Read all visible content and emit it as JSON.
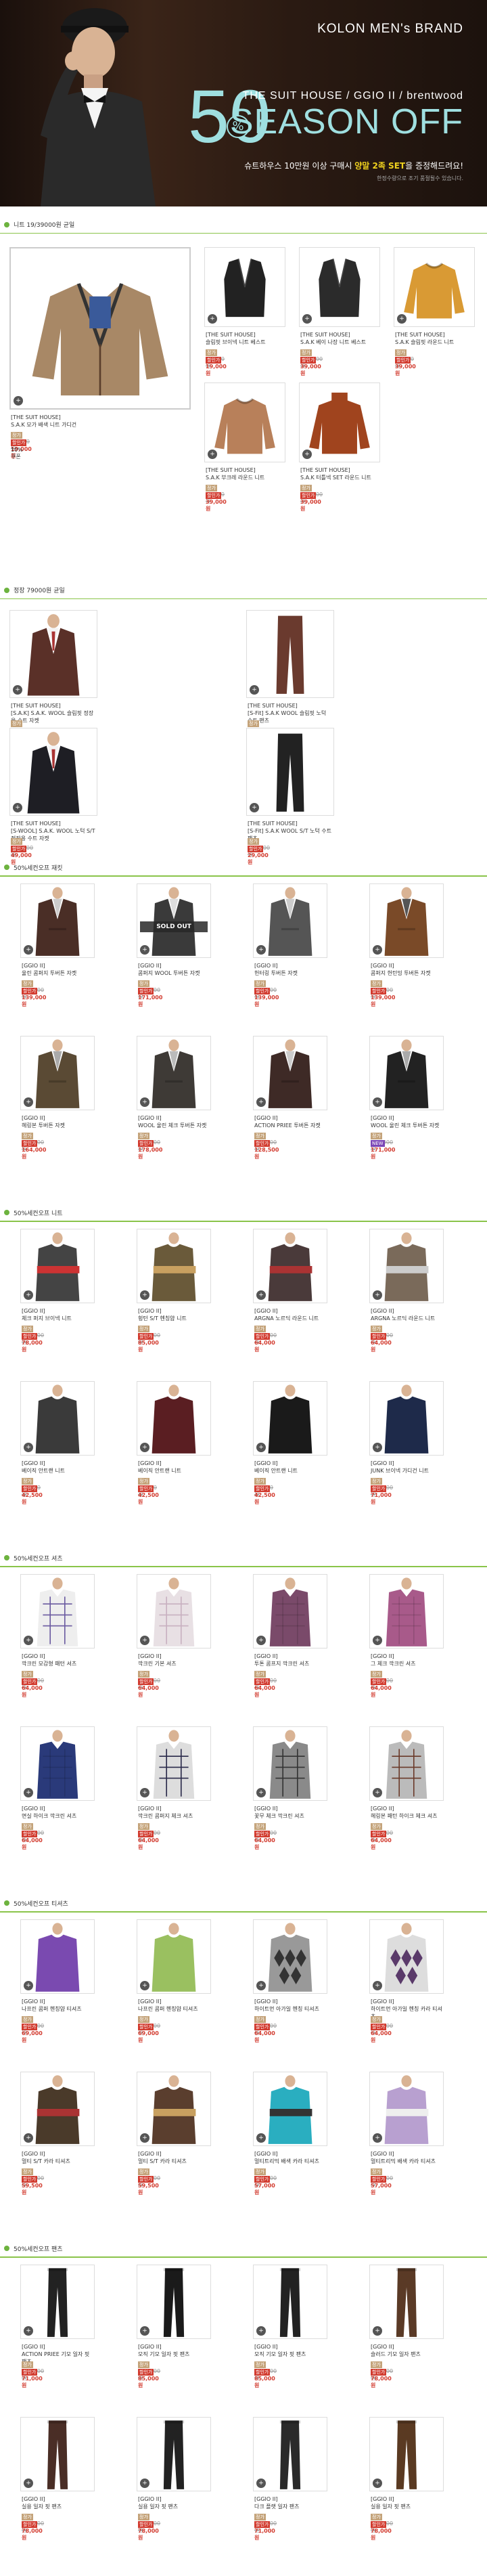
{
  "hero": {
    "brand": "KOLON MEN's BRAND",
    "percent": "50",
    "percent_sign": "%",
    "sub": "THE SUIT HOUSE / GGIO II / brentwood",
    "season": "SEASON OFF",
    "promo_pre": "슈트하우스 10만원 이상 구매시 ",
    "promo_hl": "양말 2족 SET",
    "promo_post": "을 증정해드려요!",
    "note": "한정수량으로 조기 품절될수 있습니다."
  },
  "sections": [
    {
      "title": "니트 19/39000원 균일"
    },
    {
      "title": "정장 79000원 균일"
    },
    {
      "title": "50%세컨오프 재킷"
    },
    {
      "title": "50%세컨오프 니트"
    },
    {
      "title": "50%세컨오프 셔츠"
    },
    {
      "title": "50%세컨오프 티셔츠"
    },
    {
      "title": "50%세컨오프 팬츠"
    }
  ],
  "knit": [
    {
      "name": "[THE SUIT HOUSE]\nS.A.K 모가 배색 니트 가디건",
      "orig": "99,000원",
      "now": "19,000원",
      "extra": "10% 쿠폰"
    },
    {
      "name": "[THE SUIT HOUSE]\n슬림핏 브이넥 니트 베스트",
      "orig": "75,000원",
      "now": "19,000원"
    },
    {
      "name": "[THE SUIT HOUSE]\nS.A.K 베이 나장 니트 베스트",
      "orig": "124,000원",
      "now": "39,000원"
    },
    {
      "name": "[THE SUIT HOUSE]\nS.A.K 슬림핏 라운드 니트",
      "orig": "99,000원",
      "now": "39,000원"
    },
    {
      "name": "[THE SUIT HOUSE]\nS.A.K 부크레 라운드 니트",
      "orig": "99,000원",
      "now": "39,000원"
    },
    {
      "name": "[THE SUIT HOUSE]\nS.A.K 터틀넥 SET 라운드 니트",
      "orig": "160,000원",
      "now": "39,000원"
    }
  ],
  "suit": [
    {
      "name": "[THE SUIT HOUSE]\n[S.A.K] S.A.K. WOOL 슬림핏 정장을 수트 자켓",
      "orig": "259,000원",
      "now": "49,000원"
    },
    {
      "name": "[THE SUIT HOUSE]\n[S-Fit] S.A.K WOOL 슬림핏 노턱 수트 팬츠",
      "orig": "129,000원",
      "now": "29,000원"
    },
    {
      "name": "[THE SUIT HOUSE]\n[S-WOOL] S.A.K. WOOL 노턱 S/T 정장용 수트 자켓",
      "orig": "269,000원",
      "now": "49,000원"
    },
    {
      "name": "[THE SUIT HOUSE]\n[S-Fit] S.A.K WOOL S/T 노턱 수트 팬츠",
      "orig": "149,000원",
      "now": "29,000원"
    }
  ],
  "jackets": [
    {
      "name": "[GGIO II]\n울린 콤퍼지 투버튼 자켓",
      "orig": "279,000원",
      "now": "139,000원",
      "sold": false
    },
    {
      "name": "[GGIO II]\n콤퍼지 WOOL 투버튼 자켓",
      "orig": "342,000원",
      "now": "171,000원",
      "sold": true,
      "sold_label": "SOLD OUT"
    },
    {
      "name": "[GGIO II]\n헌터링 투버튼 자켓",
      "orig": "279,000원",
      "now": "139,000원",
      "sold": false
    },
    {
      "name": "[GGIO II]\n콤퍼지 헌턴밍 투버튼 자켓",
      "orig": "279,000원",
      "now": "139,000원",
      "sold": false
    },
    {
      "name": "[GGIO II]\n헤링본 투버튼 자켓",
      "orig": "328,000원",
      "now": "164,000원",
      "sold": false
    },
    {
      "name": "[GGIO II]\nWOOL 울린 체크 투버튼 자켓",
      "orig": "356,000원",
      "now": "178,000원",
      "sold": false
    },
    {
      "name": "[GGIO II]\nACTION PRIEE 투버튼 자켓",
      "orig": "257,000원",
      "now": "128,500원",
      "sold": false
    },
    {
      "name": "[GGIO II]\nWOOL 울린 체크 투버튼 자켓",
      "orig": "342,000원",
      "now": "171,000원",
      "sold": false,
      "new": true
    }
  ],
  "knits2": [
    {
      "name": "[GGIO II]\n체크 퍼지 브이넥 니트",
      "orig": "156,000원",
      "now": "78,000원"
    },
    {
      "name": "[GGIO II]\n헝턴 S/T 헨칭얌 니트",
      "orig": "170,000원",
      "now": "85,000원"
    },
    {
      "name": "[GGIO II]\nARGNA 노르딕 라운드 니트",
      "orig": "128,000원",
      "now": "64,000원"
    },
    {
      "name": "[GGIO II]\nARGNA 노르딕 라운드 니트",
      "orig": "128,000원",
      "now": "64,000원"
    },
    {
      "name": "[GGIO II]\n베이직 안트랜 니트",
      "orig": "85,000원",
      "now": "42,500원"
    },
    {
      "name": "[GGIO II]\n베이직 안트랜 니트",
      "orig": "85,000원",
      "now": "42,500원"
    },
    {
      "name": "[GGIO II]\n베이직 안트랜 니트",
      "orig": "85,000원",
      "now": "42,500원"
    },
    {
      "name": "[GGIO II]\nJUNK 브이넥 가디건 니트",
      "orig": "142,000원",
      "now": "71,000원"
    }
  ],
  "shirts": [
    {
      "name": "[GGIO II]\n깍크린 모감형 패턴 셔츠",
      "orig": "128,000원",
      "now": "64,000원"
    },
    {
      "name": "[GGIO II]\n깍크린 기본 셔츠",
      "orig": "128,000원",
      "now": "64,000원"
    },
    {
      "name": "[GGIO II]\n투톤 콤프지 깍크린 셔츠",
      "orig": "128,000원",
      "now": "64,000원"
    },
    {
      "name": "[GGIO II]\n그 체크 깍크린 셔츠",
      "orig": "128,000원",
      "now": "64,000원"
    },
    {
      "name": "[GGIO II]\n면실 하이크 깍크린 셔츠",
      "orig": "128,000원",
      "now": "64,000원"
    },
    {
      "name": "[GGIO II]\n깍크린 콤퍼지 체크 셔츠",
      "orig": "128,000원",
      "now": "64,000원"
    },
    {
      "name": "[GGIO II]\n꽃무 체크 깍크린 셔츠",
      "orig": "128,000원",
      "now": "64,000원"
    },
    {
      "name": "[GGIO II]\n헤링본 패턴 하이크 체크 셔츠",
      "orig": "128,000원",
      "now": "64,000원"
    }
  ],
  "tees": [
    {
      "name": "[GGIO II]\n나프린 콤퍼 헨칭얌 티셔츠",
      "orig": "138,000원",
      "now": "69,000원"
    },
    {
      "name": "[GGIO II]\n나프린 콤퍼 헨칭얌 티셔츠",
      "orig": "138,000원",
      "now": "69,000원"
    },
    {
      "name": "[GGIO II]\n하이트먼 아가일 헨칭 티셔츠",
      "orig": "128,000원",
      "now": "64,000원"
    },
    {
      "name": "[GGIO II]\n하이트먼 아가일 헨칭 카라 티셔츠",
      "orig": "128,000원",
      "now": "64,000원"
    },
    {
      "name": "[GGIO II]\n멀티 S/T 카라 티셔츠",
      "orig": "119,000원",
      "now": "59,500원"
    },
    {
      "name": "[GGIO II]\n멀티 S/T 카라 티셔츠",
      "orig": "119,000원",
      "now": "59,500원"
    },
    {
      "name": "[GGIO II]\n멀티트리믹 배색 카라 티셔츠",
      "orig": "114,000원",
      "now": "57,000원"
    },
    {
      "name": "[GGIO II]\n멀티트리믹 배색 카라 티셔츠",
      "orig": "114,000원",
      "now": "57,000원"
    }
  ],
  "pants": [
    {
      "name": "[GGIO II]\nACTION PRIEE 기모 일자 핏 팬츠",
      "orig": "142,000원",
      "now": "71,000원"
    },
    {
      "name": "[GGIO II]\n모직 기모 일자 핏 팬츠",
      "orig": "170,000원",
      "now": "85,000원"
    },
    {
      "name": "[GGIO II]\n모직 기모 일자 핏 팬츠",
      "orig": "170,000원",
      "now": "85,000원"
    },
    {
      "name": "[GGIO II]\n슬러드 기모 일자 팬츠",
      "orig": "156,000원",
      "now": "78,000원"
    },
    {
      "name": "[GGIO II]\n실용 일자 핏 팬츠",
      "orig": "156,000원",
      "now": "78,000원"
    },
    {
      "name": "[GGIO II]\n실용 일자 핏 팬츠",
      "orig": "156,000원",
      "now": "78,000원"
    },
    {
      "name": "[GGIO II]\n다크 플랫 일자 팬츠",
      "orig": "142,000원",
      "now": "71,000원"
    },
    {
      "name": "[GGIO II]\n실용 일자 핏 팬츠",
      "orig": "156,000원",
      "now": "78,000원"
    }
  ],
  "labels": {
    "orig_tag": "정가",
    "sale_tag": "할인가",
    "new_tag": "NEW",
    "zoom": "+"
  },
  "colors": {
    "accent_green": "#8ac44a",
    "sale_red": "#d23b2f",
    "hero_cyan": "#9fdfe0",
    "promo_yellow": "#f0d21e"
  }
}
